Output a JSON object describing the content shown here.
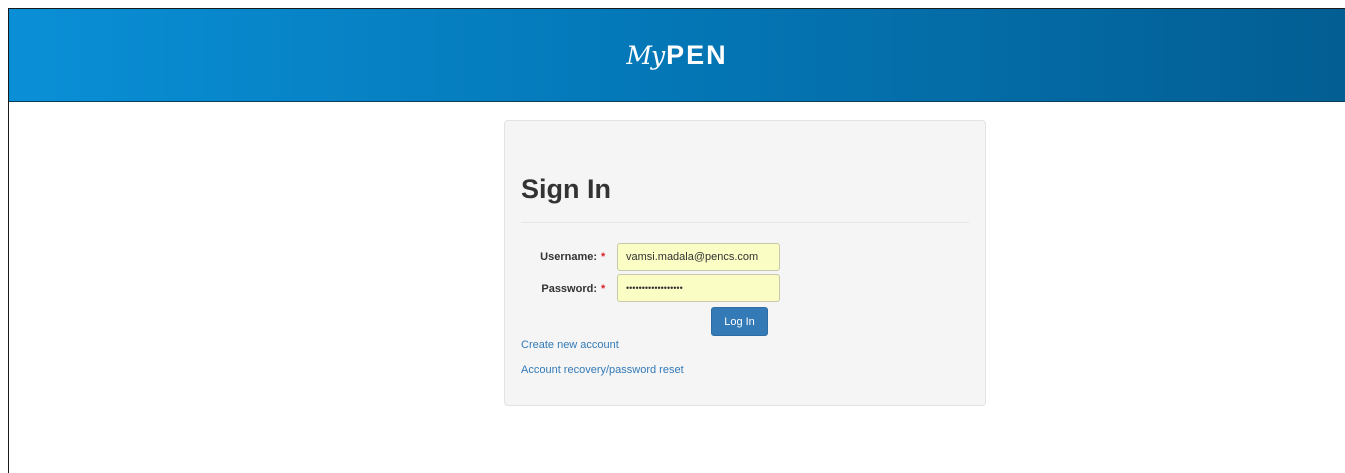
{
  "header": {
    "logo_my": "My",
    "logo_pen": "PEN"
  },
  "login": {
    "title": "Sign In",
    "username_label": "Username:",
    "password_label": "Password:",
    "required_mark": "*",
    "username_value": "vamsi.madala@pencs.com",
    "password_value": "••••••••••••••••••",
    "login_button": "Log In",
    "create_account_link": "Create new account",
    "recovery_link": "Account recovery/password reset"
  },
  "colors": {
    "header_start": "#0a8fd6",
    "header_end": "#035e93",
    "primary_button": "#337ab7",
    "link": "#337ab7",
    "required": "#d9232d",
    "autofill_bg": "#fafdc4"
  }
}
